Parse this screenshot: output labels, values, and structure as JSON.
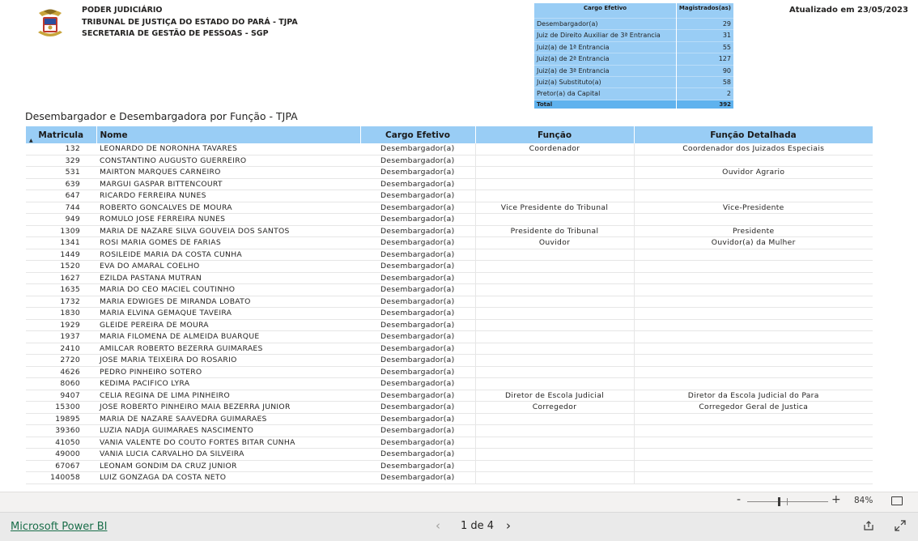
{
  "header": {
    "org_line1": "PODER JUDICIÁRIO",
    "org_line2": "TRIBUNAL DE JUSTIÇA DO ESTADO DO PARÁ - TJPA",
    "org_line3": "SECRETARIA DE GESTÃO DE PESSOAS - SGP",
    "updated": "Atualizado em 23/05/2023"
  },
  "summary": {
    "col1": "Cargo Efetivo",
    "col2": "Magistrados(as)",
    "rows": [
      {
        "cargo": "Desembargador(a)",
        "count": "29"
      },
      {
        "cargo": "Juiz de Direito Auxiliar de 3ª Entrancia",
        "count": "31"
      },
      {
        "cargo": "Juiz(a) de 1ª Entrancia",
        "count": "55"
      },
      {
        "cargo": "Juiz(a) de 2ª Entrancia",
        "count": "127"
      },
      {
        "cargo": "Juiz(a) de 3ª Entrancia",
        "count": "90"
      },
      {
        "cargo": "Juiz(a) Substituto(a)",
        "count": "58"
      },
      {
        "cargo": "Pretor(a) da Capital",
        "count": "2"
      }
    ],
    "total_label": "Total",
    "total_value": "392"
  },
  "report": {
    "title": "Desembargador e Desembargadora por Função - TJPA",
    "columns": {
      "matricula": "Matricula",
      "nome": "Nome",
      "cargo": "Cargo Efetivo",
      "funcao": "Função",
      "funcao_detalhada": "Função Detalhada"
    },
    "rows": [
      {
        "m": "132",
        "n": "LEONARDO DE NORONHA TAVARES",
        "c": "Desembargador(a)",
        "f": "Coordenador",
        "fd": "Coordenador dos Juizados Especiais"
      },
      {
        "m": "329",
        "n": "CONSTANTINO AUGUSTO GUERREIRO",
        "c": "Desembargador(a)",
        "f": "",
        "fd": ""
      },
      {
        "m": "531",
        "n": "MAIRTON MARQUES CARNEIRO",
        "c": "Desembargador(a)",
        "f": "",
        "fd": "Ouvidor Agrario"
      },
      {
        "m": "639",
        "n": "MARGUI GASPAR BITTENCOURT",
        "c": "Desembargador(a)",
        "f": "",
        "fd": ""
      },
      {
        "m": "647",
        "n": "RICARDO FERREIRA NUNES",
        "c": "Desembargador(a)",
        "f": "",
        "fd": ""
      },
      {
        "m": "744",
        "n": "ROBERTO GONCALVES DE MOURA",
        "c": "Desembargador(a)",
        "f": "Vice Presidente do Tribunal",
        "fd": "Vice-Presidente"
      },
      {
        "m": "949",
        "n": "ROMULO JOSE FERREIRA NUNES",
        "c": "Desembargador(a)",
        "f": "",
        "fd": ""
      },
      {
        "m": "1309",
        "n": "MARIA DE NAZARE SILVA GOUVEIA DOS SANTOS",
        "c": "Desembargador(a)",
        "f": "Presidente do Tribunal",
        "fd": "Presidente"
      },
      {
        "m": "1341",
        "n": "ROSI MARIA GOMES DE FARIAS",
        "c": "Desembargador(a)",
        "f": "Ouvidor",
        "fd": "Ouvidor(a) da Mulher"
      },
      {
        "m": "1449",
        "n": "ROSILEIDE MARIA DA COSTA CUNHA",
        "c": "Desembargador(a)",
        "f": "",
        "fd": ""
      },
      {
        "m": "1520",
        "n": "EVA DO AMARAL COELHO",
        "c": "Desembargador(a)",
        "f": "",
        "fd": ""
      },
      {
        "m": "1627",
        "n": "EZILDA PASTANA MUTRAN",
        "c": "Desembargador(a)",
        "f": "",
        "fd": ""
      },
      {
        "m": "1635",
        "n": "MARIA DO CEO MACIEL COUTINHO",
        "c": "Desembargador(a)",
        "f": "",
        "fd": ""
      },
      {
        "m": "1732",
        "n": "MARIA EDWIGES DE MIRANDA LOBATO",
        "c": "Desembargador(a)",
        "f": "",
        "fd": ""
      },
      {
        "m": "1830",
        "n": "MARIA ELVINA GEMAQUE TAVEIRA",
        "c": "Desembargador(a)",
        "f": "",
        "fd": ""
      },
      {
        "m": "1929",
        "n": "GLEIDE PEREIRA DE MOURA",
        "c": "Desembargador(a)",
        "f": "",
        "fd": ""
      },
      {
        "m": "1937",
        "n": "MARIA FILOMENA DE ALMEIDA BUARQUE",
        "c": "Desembargador(a)",
        "f": "",
        "fd": ""
      },
      {
        "m": "2410",
        "n": "AMILCAR ROBERTO BEZERRA GUIMARAES",
        "c": "Desembargador(a)",
        "f": "",
        "fd": ""
      },
      {
        "m": "2720",
        "n": "JOSE MARIA TEIXEIRA DO ROSARIO",
        "c": "Desembargador(a)",
        "f": "",
        "fd": ""
      },
      {
        "m": "4626",
        "n": "PEDRO PINHEIRO SOTERO",
        "c": "Desembargador(a)",
        "f": "",
        "fd": ""
      },
      {
        "m": "8060",
        "n": "KEDIMA PACIFICO LYRA",
        "c": "Desembargador(a)",
        "f": "",
        "fd": ""
      },
      {
        "m": "9407",
        "n": "CELIA REGINA DE LIMA PINHEIRO",
        "c": "Desembargador(a)",
        "f": "Diretor de Escola Judicial",
        "fd": "Diretor da Escola Judicial do Para"
      },
      {
        "m": "15300",
        "n": "JOSE ROBERTO PINHEIRO MAIA BEZERRA JUNIOR",
        "c": "Desembargador(a)",
        "f": "Corregedor",
        "fd": "Corregedor Geral de Justica"
      },
      {
        "m": "19895",
        "n": "MARIA DE NAZARE SAAVEDRA GUIMARAES",
        "c": "Desembargador(a)",
        "f": "",
        "fd": ""
      },
      {
        "m": "39360",
        "n": "LUZIA NADJA GUIMARAES NASCIMENTO",
        "c": "Desembargador(a)",
        "f": "",
        "fd": ""
      },
      {
        "m": "41050",
        "n": "VANIA VALENTE DO COUTO FORTES BITAR CUNHA",
        "c": "Desembargador(a)",
        "f": "",
        "fd": ""
      },
      {
        "m": "49000",
        "n": "VANIA LUCIA CARVALHO DA SILVEIRA",
        "c": "Desembargador(a)",
        "f": "",
        "fd": ""
      },
      {
        "m": "67067",
        "n": "LEONAM GONDIM DA CRUZ JUNIOR",
        "c": "Desembargador(a)",
        "f": "",
        "fd": ""
      },
      {
        "m": "140058",
        "n": "LUIZ GONZAGA DA COSTA NETO",
        "c": "Desembargador(a)",
        "f": "",
        "fd": ""
      }
    ]
  },
  "zoom": {
    "minus": "-",
    "plus": "+",
    "percent": "84%",
    "level": 0.84
  },
  "footer": {
    "brand_link": "Microsoft Power BI",
    "page_indicator": "1 de 4"
  },
  "colors": {
    "table_header": "#99cdf5",
    "total_row": "#5fb2ee",
    "link": "#1a6e4a"
  }
}
